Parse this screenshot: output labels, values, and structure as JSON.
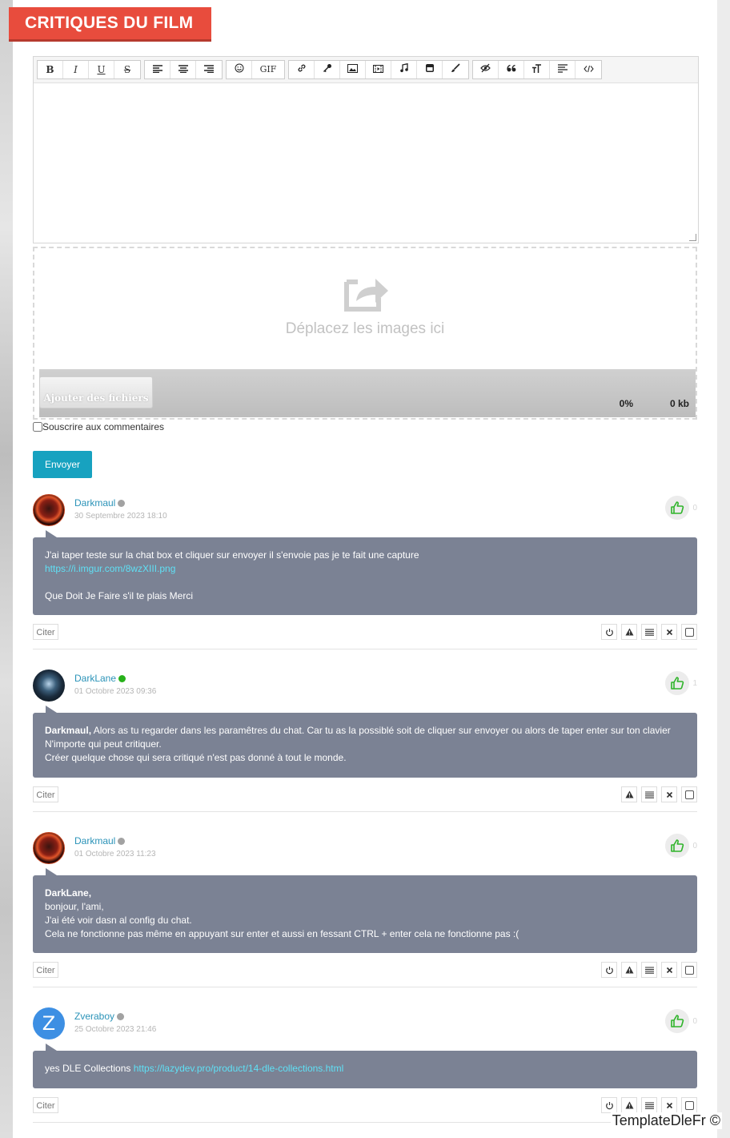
{
  "section": {
    "title": "CRITIQUES DU FILM"
  },
  "editor": {
    "toolbar": {
      "bold": "B",
      "italic": "I",
      "underline": "U",
      "strike": "S",
      "gif": "GIF"
    },
    "text_value": ""
  },
  "dropzone": {
    "text": "Déplacez les images ici",
    "add_files": "Ajouter des fichiers",
    "progress_percent": "0%",
    "progress_size": "0 kb"
  },
  "subscribe_label": "Souscrire aux commentaires",
  "send_label": "Envoyer",
  "cite_label": "Citer",
  "comments": [
    {
      "author": "Darkmaul",
      "status": "offline",
      "date": "30 Septembre 2023 18:10",
      "likes": "0",
      "line1": "J'ai taper teste sur la chat box et cliquer sur envoyer il s'envoie pas je te fait une capture",
      "link": "https://i.imgur.com/8wzXIII.png",
      "line2": "Que Doit Je Faire s'il te plais Merci"
    },
    {
      "author": "DarkLane",
      "status": "online",
      "date": "01 Octobre 2023 09:36",
      "likes": "1",
      "mention": "Darkmaul,",
      "line1": " Alors as tu regarder dans les paramêtres du chat. Car tu as la possiblé soit de cliquer sur envoyer ou alors de taper enter sur ton clavier",
      "line2": "N'importe qui peut critiquer.",
      "line3": "Créer quelque chose qui sera critiqué n'est pas donné à tout le monde."
    },
    {
      "author": "Darkmaul",
      "status": "offline",
      "date": "01 Octobre 2023 11:23",
      "likes": "0",
      "mention": "DarkLane,",
      "line1": "bonjour, l'ami,",
      "line2": "J'ai été voir dasn al config du chat.",
      "line3": "Cela ne fonctionne pas même en appuyant sur enter et aussi en fessant CTRL + enter cela ne fonctionne pas :("
    },
    {
      "author": "Zveraboy",
      "status": "offline",
      "avatar_letter": "Z",
      "date": "25 Octobre 2023 21:46",
      "likes": "0",
      "text": "yes DLE Collections ",
      "link": "https://lazydev.pro/product/14-dle-collections.html"
    }
  ],
  "watermark": "TemplateDleFr ©"
}
